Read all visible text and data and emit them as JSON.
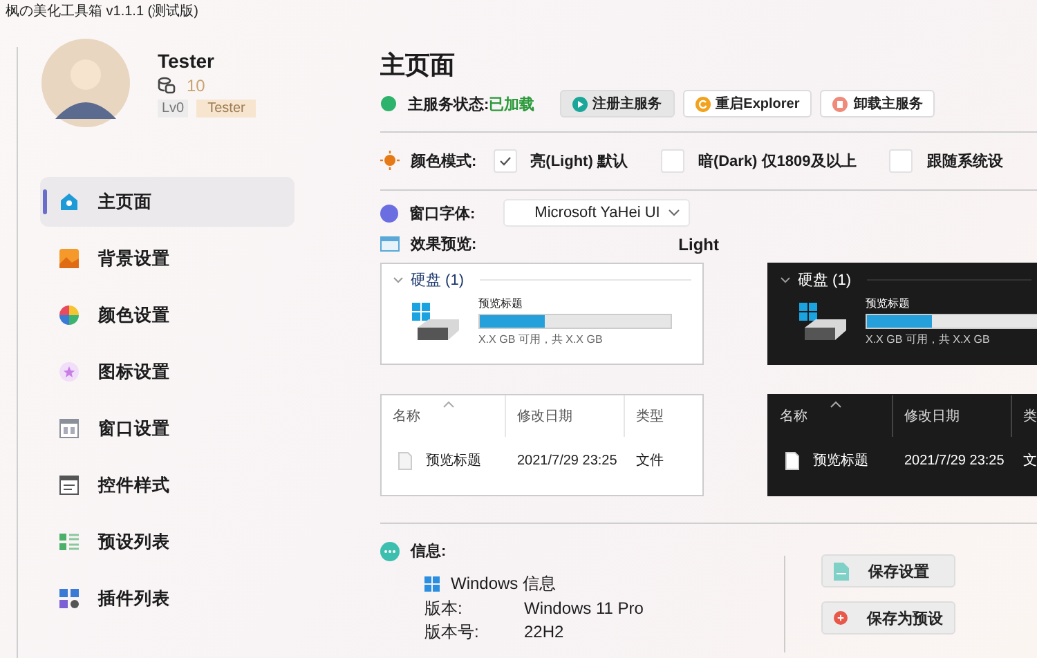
{
  "window": {
    "title": "枫の美化工具箱 v1.1.1 (测试版)"
  },
  "profile": {
    "name": "Tester",
    "coins": "10",
    "level": "Lv0",
    "badge": "Tester"
  },
  "nav": [
    {
      "label": "主页面",
      "selected": true
    },
    {
      "label": "背景设置",
      "selected": false
    },
    {
      "label": "颜色设置",
      "selected": false
    },
    {
      "label": "图标设置",
      "selected": false
    },
    {
      "label": "窗口设置",
      "selected": false
    },
    {
      "label": "控件样式",
      "selected": false
    },
    {
      "label": "预设列表",
      "selected": false
    },
    {
      "label": "插件列表",
      "selected": false
    }
  ],
  "page": {
    "title": "主页面"
  },
  "service": {
    "label": "主服务状态:",
    "status": "已加载",
    "loaded": true,
    "buttons": [
      {
        "label": "注册主服务",
        "kind": "play",
        "disabled": true
      },
      {
        "label": "重启Explorer",
        "kind": "restart",
        "disabled": false
      },
      {
        "label": "卸载主服务",
        "kind": "remove",
        "disabled": false
      }
    ]
  },
  "color_mode": {
    "label": "颜色模式:",
    "options": [
      {
        "label": "亮(Light) 默认",
        "checked": true
      },
      {
        "label": "暗(Dark) 仅1809及以上",
        "checked": false
      },
      {
        "label": "跟随系统设",
        "checked": false
      }
    ]
  },
  "font": {
    "label": "窗口字体:",
    "value": "Microsoft YaHei UI"
  },
  "preview": {
    "label": "效果预览:",
    "mode": "Light",
    "panels": [
      {
        "dark": false,
        "group": "硬盘 (1)",
        "drive_title": "预览标题",
        "level": 0.34,
        "drive_info": "X.X GB 可用，共 X.X GB",
        "columns": [
          "名称",
          "修改日期",
          "类型"
        ],
        "file": {
          "name": "预览标题",
          "date": "2021/7/29 23:25",
          "type": "文件"
        }
      },
      {
        "dark": true,
        "group": "硬盘 (1)",
        "drive_title": "预览标题",
        "level": 0.34,
        "drive_info": "X.X GB 可用，共 X.X GB",
        "columns": [
          "名称",
          "修改日期",
          "类"
        ],
        "file": {
          "name": "预览标题",
          "date": "2021/7/29 23:25",
          "type": "文"
        }
      }
    ]
  },
  "info": {
    "label": "信息:",
    "section": "Windows 信息",
    "rows": [
      {
        "key": "版本:",
        "value": "Windows 11 Pro"
      },
      {
        "key": "版本号:",
        "value": "22H2"
      }
    ]
  },
  "actions": [
    {
      "label": "保存设置",
      "kind": "save"
    },
    {
      "label": "保存为预设",
      "kind": "preset"
    }
  ]
}
